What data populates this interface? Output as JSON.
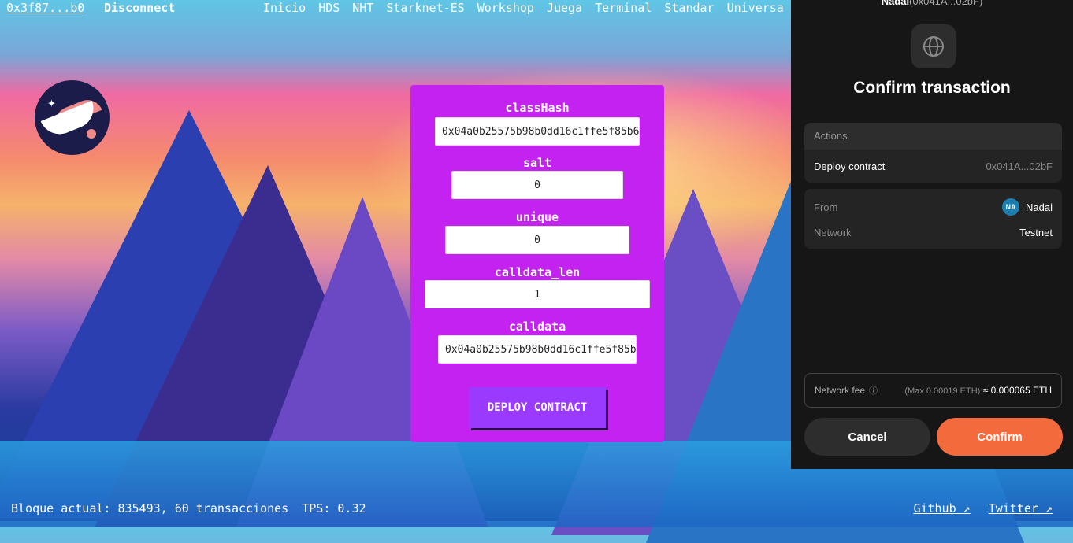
{
  "topbar": {
    "wallet": "0x3f87...b0",
    "disconnect": "Disconnect",
    "nav": [
      "Inicio",
      "HDS",
      "NHT",
      "Starknet-ES",
      "Workshop",
      "Juega",
      "Terminal",
      "Standar",
      "Universa"
    ]
  },
  "form": {
    "fields": [
      {
        "label": "classHash",
        "value": "0x04a0b25575b98b0dd16c1ffe5f85b6"
      },
      {
        "label": "salt",
        "value": "0"
      },
      {
        "label": "unique",
        "value": "0"
      },
      {
        "label": "calldata_len",
        "value": "1"
      },
      {
        "label": "calldata",
        "value": "0x04a0b25575b98b0dd16c1ffe5f85b"
      }
    ],
    "deploy_label": "DEPLOY CONTRACT"
  },
  "footer": {
    "block": "Bloque actual: 835493, 60 transacciones",
    "tps": "TPS: 0.32",
    "github": "Github ↗",
    "twitter": "Twitter ↗"
  },
  "popup": {
    "account_name": "Nadai",
    "account_addr": "(0x041A...02bF)",
    "title": "Confirm transaction",
    "actions_header": "Actions",
    "action_name": "Deploy contract",
    "action_addr": "0x041A...02bF",
    "from_label": "From",
    "from_avatar": "NA",
    "from_name": "Nadai",
    "network_label": "Network",
    "network_value": "Testnet",
    "fee_label": "Network fee",
    "fee_max": "(Max 0.00019 ETH)",
    "fee_value": "≈ 0.000065 ETH",
    "cancel": "Cancel",
    "confirm": "Confirm"
  },
  "colors": {
    "panel": "#c322f0",
    "deploy_button": "#9b3aff",
    "confirm_button": "#f36a3d",
    "popup_bg": "#161616"
  }
}
